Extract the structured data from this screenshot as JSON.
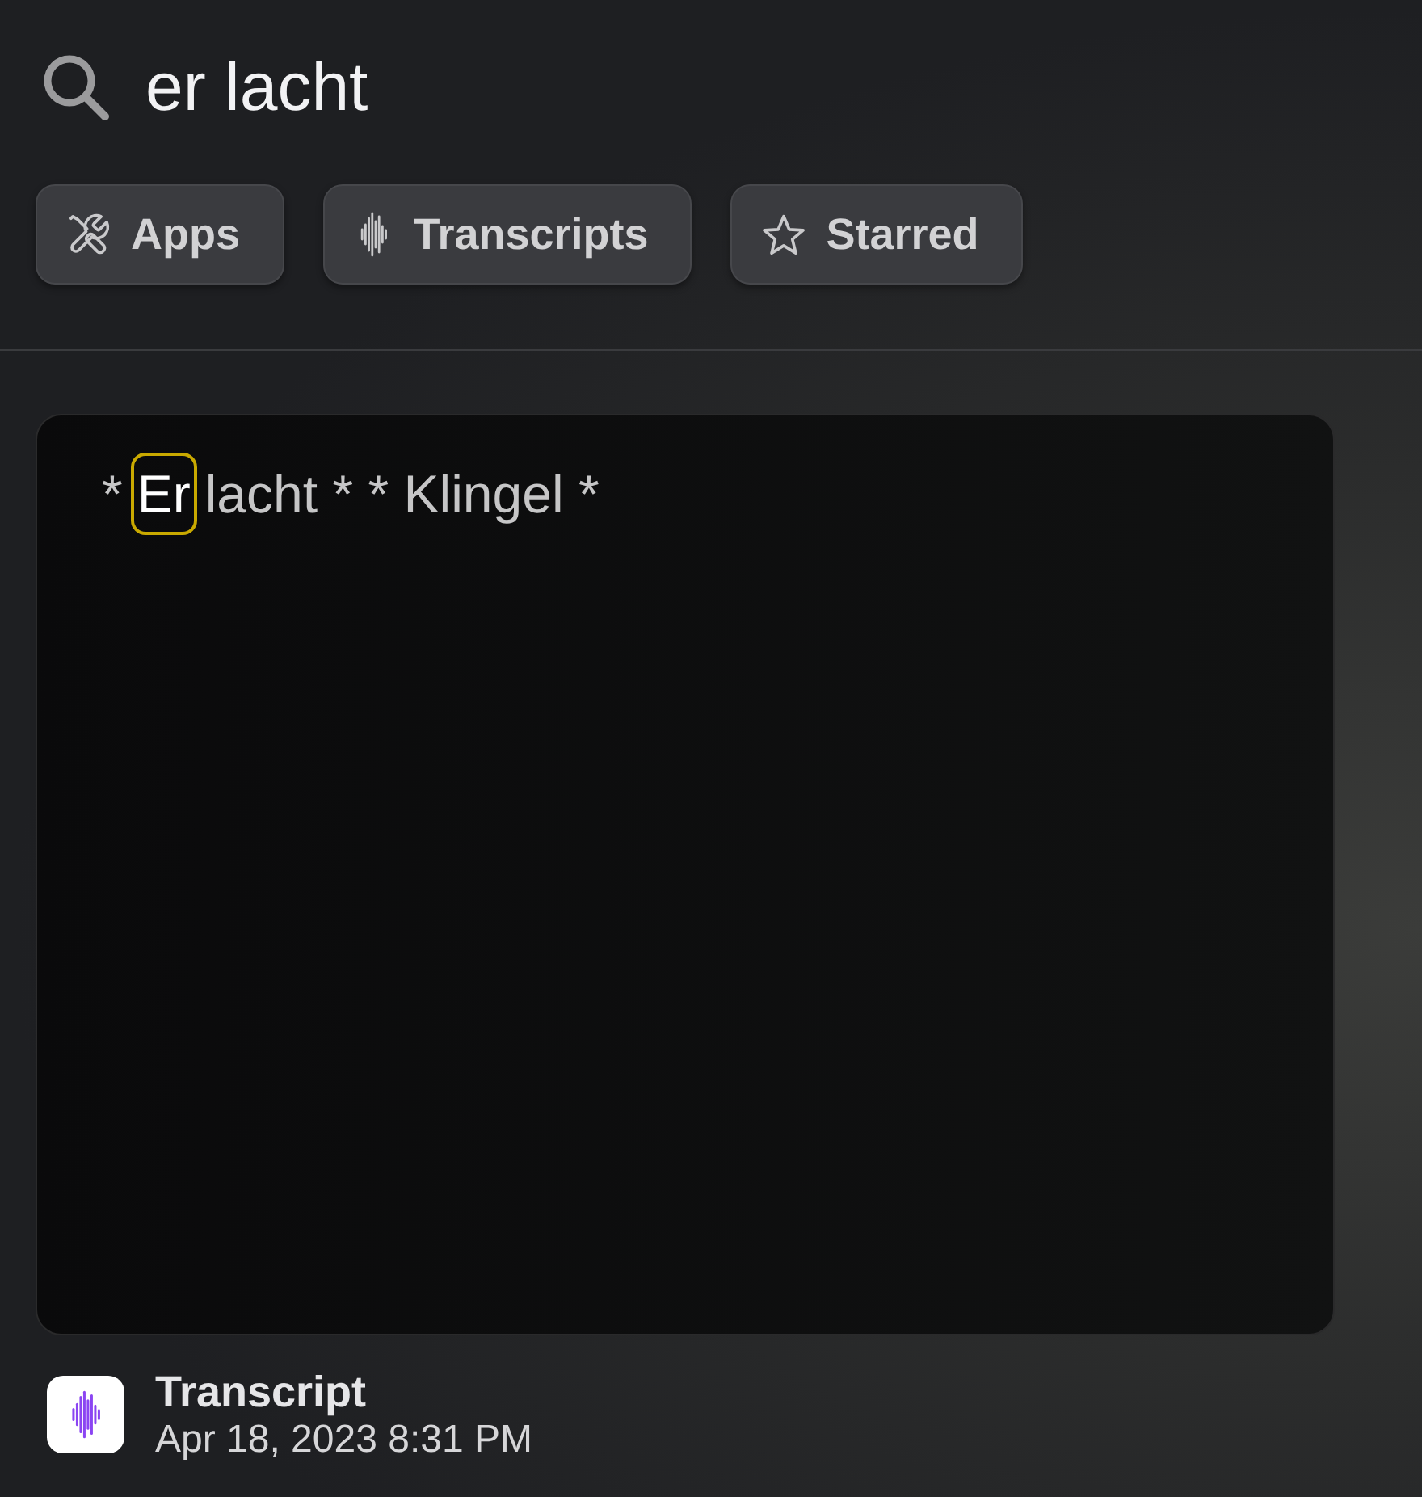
{
  "search": {
    "query": "er lacht"
  },
  "filters": [
    {
      "kind": "apps",
      "label": "Apps",
      "selected": false
    },
    {
      "kind": "transcripts",
      "label": "Transcripts",
      "selected": false
    },
    {
      "kind": "starred",
      "label": "Starred",
      "selected": false
    }
  ],
  "preview": {
    "segments": [
      {
        "text": "*",
        "highlighted": false
      },
      {
        "text": "Er",
        "highlighted": true
      },
      {
        "text": "lacht * * Klingel *",
        "highlighted": false
      }
    ]
  },
  "result": {
    "title": "Transcript",
    "date": "Apr 18, 2023 8:31 PM"
  }
}
